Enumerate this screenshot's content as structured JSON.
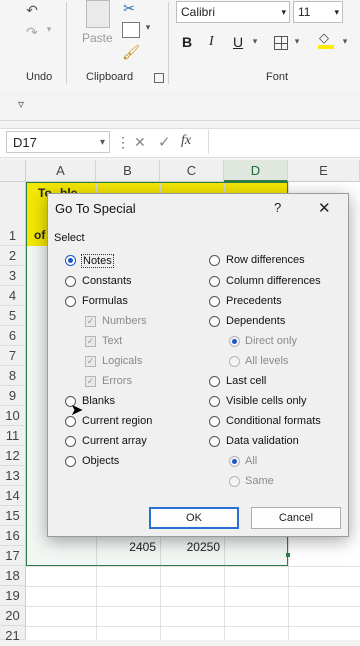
{
  "ribbon": {
    "paste_label": "Paste",
    "groups": {
      "undo": "Undo",
      "clipboard": "Clipboard",
      "font": "Font"
    },
    "font_name": "Calibri",
    "font_size": "11",
    "format_buttons": {
      "bold": "B",
      "italic": "I",
      "underline": "U"
    },
    "collapse_glyph": "▿"
  },
  "formula_bar": {
    "name_box": "D17",
    "fx": "fx",
    "value": ""
  },
  "sheet": {
    "columns": [
      "A",
      "B",
      "C",
      "D",
      "E"
    ],
    "rows": [
      "1",
      "2",
      "3",
      "4",
      "5",
      "6",
      "7",
      "8",
      "9",
      "10",
      "11",
      "12",
      "13",
      "14",
      "15",
      "16",
      "17",
      "18",
      "19",
      "20",
      "21"
    ],
    "header_cell_text_1": "To",
    "header_cell_text_1b": "ble",
    "header_cell_text_2": "of",
    "row17": {
      "B": "2405",
      "C": "20250"
    }
  },
  "dialog": {
    "title": "Go To Special",
    "help": "?",
    "close": "✕",
    "section": "Select",
    "left_options": [
      {
        "label": "Notes",
        "checked": true
      },
      {
        "label": "Constants"
      },
      {
        "label": "Formulas"
      },
      {
        "label": "Numbers",
        "sub": true
      },
      {
        "label": "Text",
        "sub": true
      },
      {
        "label": "Logicals",
        "sub": true
      },
      {
        "label": "Errors",
        "sub": true
      },
      {
        "label": "Blanks"
      },
      {
        "label": "Current region"
      },
      {
        "label": "Current array"
      },
      {
        "label": "Objects"
      }
    ],
    "right_options": [
      {
        "label": "Row differences"
      },
      {
        "label": "Column differences"
      },
      {
        "label": "Precedents"
      },
      {
        "label": "Dependents"
      },
      {
        "label": "Direct only",
        "sub": true
      },
      {
        "label": "All levels",
        "sub": true
      },
      {
        "label": "Last cell"
      },
      {
        "label": "Visible cells only"
      },
      {
        "label": "Conditional formats"
      },
      {
        "label": "Data validation"
      },
      {
        "label": "All",
        "sub": true
      },
      {
        "label": "Same",
        "sub": true
      }
    ],
    "ok": "OK",
    "cancel": "Cancel"
  },
  "colors": {
    "accent": "#1a56c4",
    "selection": "#2e7d46",
    "highlight": "#ffee00"
  }
}
